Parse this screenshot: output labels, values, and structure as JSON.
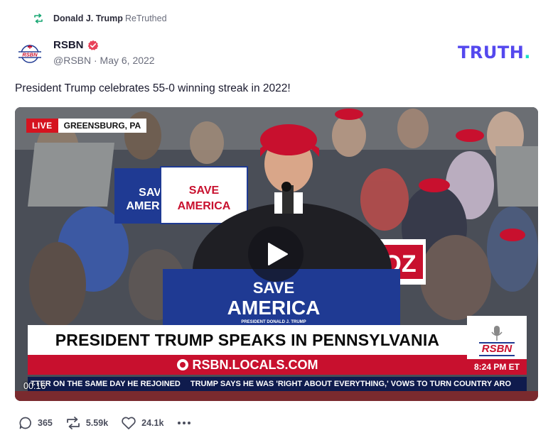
{
  "retruth": {
    "icon": "retruth-icon",
    "user": "Donald J. Trump",
    "action": "ReTruthed"
  },
  "author": {
    "name": "RSBN",
    "avatar_text": "RSBN",
    "verified_icon": "verified-badge-icon",
    "meta": "@RSBN · May 6, 2022"
  },
  "brand": {
    "text": "TRUTH",
    "dot": ".",
    "color": "#5448ee",
    "dot_color": "#17e2c7"
  },
  "post": {
    "text": "President Trump celebrates 55-0 winning streak in 2022!"
  },
  "video": {
    "live_label": "LIVE",
    "location": "GREENSBURG, PA",
    "podium_line1": "SAVE",
    "podium_line2": "AMERICA",
    "podium_line3": "PRESIDENT DONALD J. TRUMP",
    "sign_save": "SAVE",
    "sign_america": "AMERICA",
    "banner_headline": "PRESIDENT TRUMP SPEAKS IN PENNSYLVANIA",
    "banner_url": "RSBN.LOCALS.COM",
    "logo": "RSBN",
    "time": "8:24 PM ET",
    "ticker_1": "TTER ON THE SAME DAY HE REJOINED",
    "ticker_2": "TRUMP SAYS HE WAS 'RIGHT ABOUT EVERYTHING,' VOWS TO TURN COUNTRY ARO",
    "timestamp": "00:16",
    "play_icon": "play-icon",
    "accent_red": "#c8102e",
    "accent_blue": "#1f3a93"
  },
  "actions": {
    "replies": "365",
    "retruths": "5.59k",
    "likes": "24.1k",
    "reply_icon": "comment-icon",
    "retruth_icon": "retruth-icon",
    "like_icon": "heart-icon",
    "more_icon": "more-icon"
  }
}
